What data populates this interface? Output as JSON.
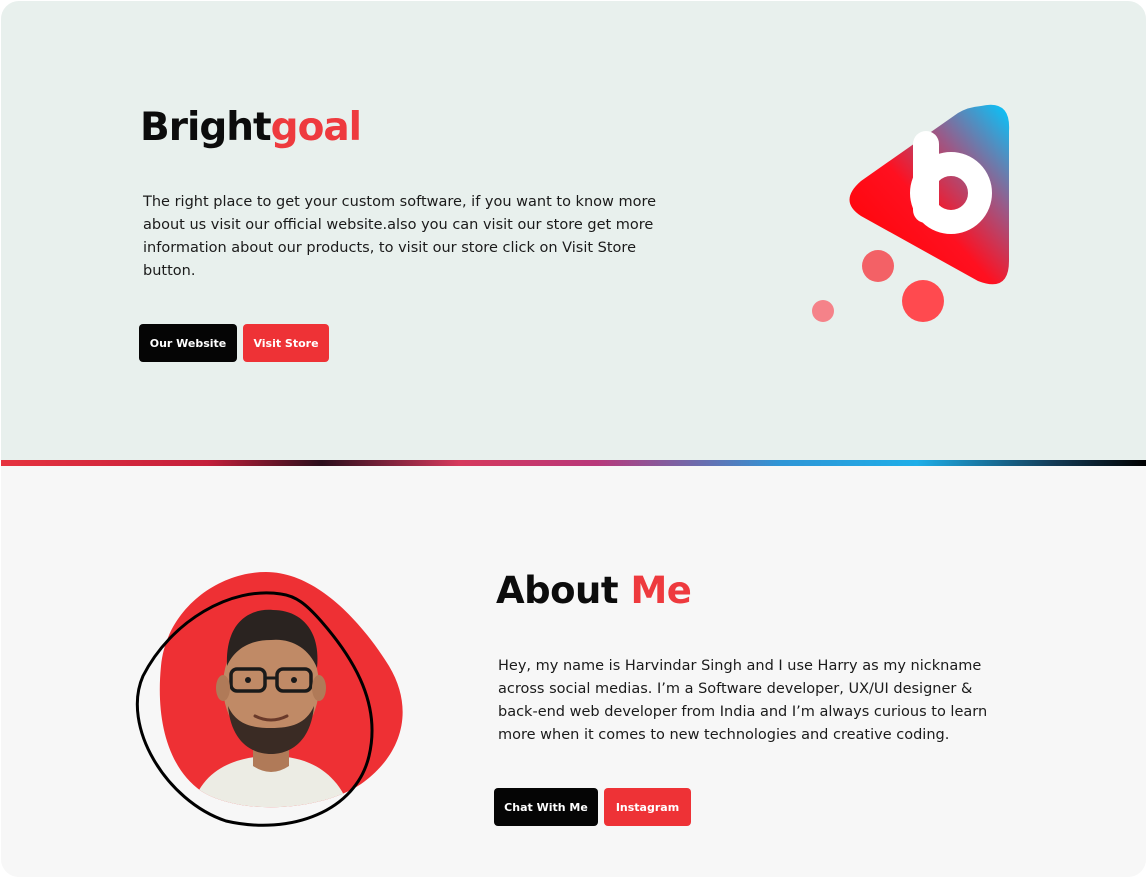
{
  "hero": {
    "title_part1": "Bright",
    "title_part2": "goal",
    "description": "The right place to get your custom software, if you want to know more about us visit our official website.also you can visit our store get more information about our products, to visit our store click on Visit Store button.",
    "buttons": {
      "website": "Our Website",
      "store": "Visit Store"
    },
    "logo_letter": "b"
  },
  "about": {
    "title_part1": "About",
    "title_part2": "Me",
    "description": "Hey, my name is Harvindar Singh and I use Harry as my nickname across social medias. I’m a Software developer, UX/UI designer & back-end web developer from India and I’m always curious to learn more when it comes to new technologies and creative coding.",
    "buttons": {
      "chat": "Chat With Me",
      "instagram": "Instagram"
    }
  },
  "colors": {
    "accent": "#ee3a3e",
    "hero_bg": "#e8f0ed",
    "about_bg": "#f7f7f7",
    "dark_button": "#050505"
  }
}
